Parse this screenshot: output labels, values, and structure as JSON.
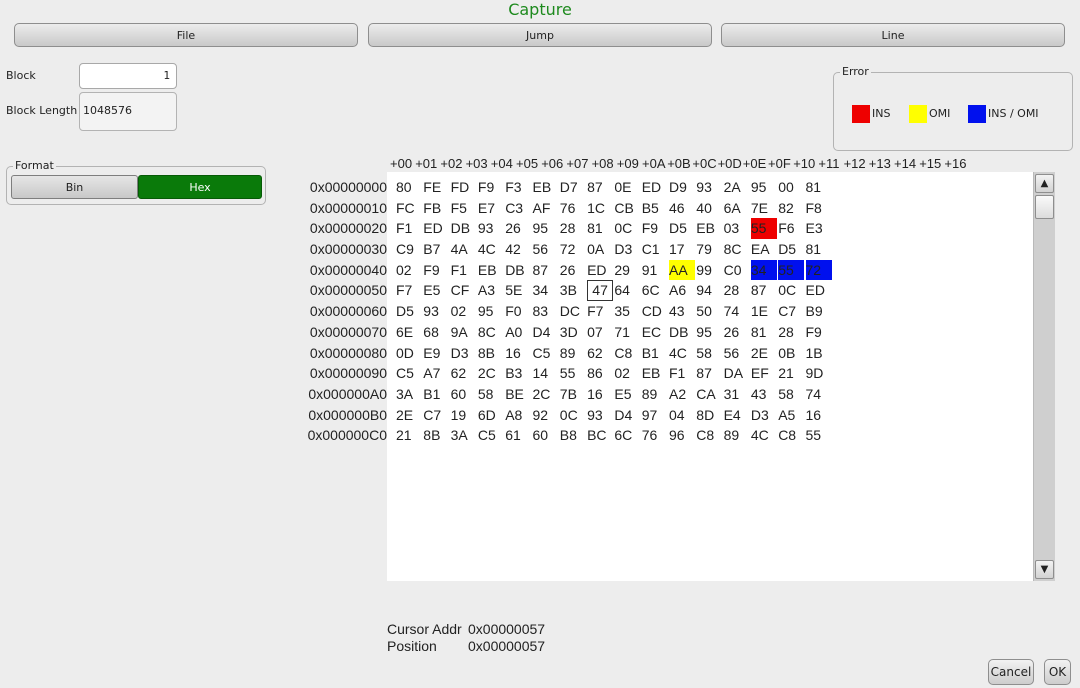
{
  "window": {
    "title": "Capture"
  },
  "toolbar": {
    "file": "File",
    "jump": "Jump",
    "line": "Line"
  },
  "block": {
    "label": "Block",
    "value": "1",
    "length_label": "Block Length",
    "length_value": "1048576"
  },
  "format": {
    "title": "Format",
    "bin": "Bin",
    "hex": "Hex",
    "selected": "Hex",
    "active_color": "#0a7a0a"
  },
  "error": {
    "title": "Error",
    "items": [
      {
        "label": "INS",
        "color": "#ee0000"
      },
      {
        "label": "OMI",
        "color": "#ffff00"
      },
      {
        "label": "INS / OMI",
        "color": "#0010ee"
      }
    ]
  },
  "hex": {
    "columns": [
      "+00",
      "+01",
      "+02",
      "+03",
      "+04",
      "+05",
      "+06",
      "+07",
      "+08",
      "+09",
      "+0A",
      "+0B",
      "+0C",
      "+0D",
      "+0E",
      "+0F",
      "+10",
      "+11",
      "+12",
      "+13",
      "+14",
      "+15",
      "+16"
    ],
    "rows": [
      {
        "addr": "0x00000000",
        "bytes": [
          "80",
          "FE",
          "FD",
          "F9",
          "F3",
          "EB",
          "D7",
          "87",
          "0E",
          "ED",
          "D9",
          "93",
          "2A",
          "95",
          "00",
          "81"
        ]
      },
      {
        "addr": "0x00000010",
        "bytes": [
          "FC",
          "FB",
          "F5",
          "E7",
          "C3",
          "AF",
          "76",
          "1C",
          "CB",
          "B5",
          "46",
          "40",
          "6A",
          "7E",
          "82",
          "F8"
        ]
      },
      {
        "addr": "0x00000020",
        "bytes": [
          "F1",
          "ED",
          "DB",
          "93",
          "26",
          "95",
          "28",
          "81",
          "0C",
          "F9",
          "D5",
          "EB",
          "03",
          "55",
          "F6",
          "E3"
        ]
      },
      {
        "addr": "0x00000030",
        "bytes": [
          "C9",
          "B7",
          "4A",
          "4C",
          "42",
          "56",
          "72",
          "0A",
          "D3",
          "C1",
          "17",
          "79",
          "8C",
          "EA",
          "D5",
          "81"
        ]
      },
      {
        "addr": "0x00000040",
        "bytes": [
          "02",
          "F9",
          "F1",
          "EB",
          "DB",
          "87",
          "26",
          "ED",
          "29",
          "91",
          "AA",
          "99",
          "C0",
          "34",
          "55",
          "72"
        ]
      },
      {
        "addr": "0x00000050",
        "bytes": [
          "F7",
          "E5",
          "CF",
          "A3",
          "5E",
          "34",
          "3B",
          "47",
          "64",
          "6C",
          "A6",
          "94",
          "28",
          "87",
          "0C",
          "ED"
        ]
      },
      {
        "addr": "0x00000060",
        "bytes": [
          "D5",
          "93",
          "02",
          "95",
          "F0",
          "83",
          "DC",
          "F7",
          "35",
          "CD",
          "43",
          "50",
          "74",
          "1E",
          "C7",
          "B9"
        ]
      },
      {
        "addr": "0x00000070",
        "bytes": [
          "6E",
          "68",
          "9A",
          "8C",
          "A0",
          "D4",
          "3D",
          "07",
          "71",
          "EC",
          "DB",
          "95",
          "26",
          "81",
          "28",
          "F9"
        ]
      },
      {
        "addr": "0x00000080",
        "bytes": [
          "0D",
          "E9",
          "D3",
          "8B",
          "16",
          "C5",
          "89",
          "62",
          "C8",
          "B1",
          "4C",
          "58",
          "56",
          "2E",
          "0B",
          "1B"
        ]
      },
      {
        "addr": "0x00000090",
        "bytes": [
          "C5",
          "A7",
          "62",
          "2C",
          "B3",
          "14",
          "55",
          "86",
          "02",
          "EB",
          "F1",
          "87",
          "DA",
          "EF",
          "21",
          "9D"
        ]
      },
      {
        "addr": "0x000000A0",
        "bytes": [
          "3A",
          "B1",
          "60",
          "58",
          "BE",
          "2C",
          "7B",
          "16",
          "E5",
          "89",
          "A2",
          "CA",
          "31",
          "43",
          "58",
          "74"
        ]
      },
      {
        "addr": "0x000000B0",
        "bytes": [
          "2E",
          "C7",
          "19",
          "6D",
          "A8",
          "92",
          "0C",
          "93",
          "D4",
          "97",
          "04",
          "8D",
          "E4",
          "D3",
          "A5",
          "16"
        ]
      },
      {
        "addr": "0x000000C0",
        "bytes": [
          "21",
          "8B",
          "3A",
          "C5",
          "61",
          "60",
          "B8",
          "BC",
          "6C",
          "76",
          "96",
          "C8",
          "89",
          "4C",
          "C8",
          "55"
        ]
      }
    ],
    "highlights": [
      {
        "row": 2,
        "col": 13,
        "type": "ins"
      },
      {
        "row": 4,
        "col": 10,
        "type": "omi"
      },
      {
        "row": 4,
        "col": 13,
        "type": "insomi"
      },
      {
        "row": 4,
        "col": 14,
        "type": "insomi"
      },
      {
        "row": 4,
        "col": 15,
        "type": "insomi"
      }
    ],
    "cursor": {
      "row": 5,
      "col": 7
    }
  },
  "status": {
    "cursor_label": "Cursor Addr",
    "cursor_value": "0x00000057",
    "position_label": "Position",
    "position_value": "0x00000057"
  },
  "dialog": {
    "cancel": "Cancel",
    "ok": "OK"
  },
  "icons": {
    "scroll_up": "triangle-up-icon",
    "scroll_down": "triangle-down-icon"
  }
}
